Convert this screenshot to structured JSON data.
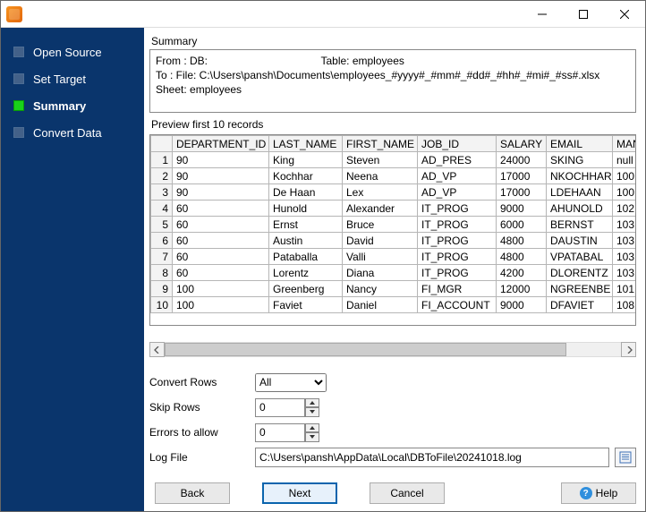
{
  "titlebar": {
    "title": ""
  },
  "sidebar": {
    "steps": [
      {
        "label": "Open Source",
        "active": false
      },
      {
        "label": "Set Target",
        "active": false
      },
      {
        "label": "Summary",
        "active": true
      },
      {
        "label": "Convert Data",
        "active": false
      }
    ]
  },
  "summary": {
    "heading": "Summary",
    "line1": "From : DB:",
    "line1_table_label": "Table: employees",
    "line2": "To : File: C:\\Users\\pansh\\Documents\\employees_#yyyy#_#mm#_#dd#_#hh#_#mi#_#ss#.xlsx Sheet: employees"
  },
  "preview": {
    "heading": "Preview first 10 records",
    "columns": [
      "DEPARTMENT_ID",
      "LAST_NAME",
      "FIRST_NAME",
      "JOB_ID",
      "SALARY",
      "EMAIL",
      "MANAG"
    ],
    "rows": [
      {
        "n": "1",
        "cells": [
          "90",
          "King",
          "Steven",
          "AD_PRES",
          "24000",
          "SKING",
          "null"
        ]
      },
      {
        "n": "2",
        "cells": [
          "90",
          "Kochhar",
          "Neena",
          "AD_VP",
          "17000",
          "NKOCHHAR",
          "100"
        ]
      },
      {
        "n": "3",
        "cells": [
          "90",
          "De Haan",
          "Lex",
          "AD_VP",
          "17000",
          "LDEHAAN",
          "100"
        ]
      },
      {
        "n": "4",
        "cells": [
          "60",
          "Hunold",
          "Alexander",
          "IT_PROG",
          "9000",
          "AHUNOLD",
          "102"
        ]
      },
      {
        "n": "5",
        "cells": [
          "60",
          "Ernst",
          "Bruce",
          "IT_PROG",
          "6000",
          "BERNST",
          "103"
        ]
      },
      {
        "n": "6",
        "cells": [
          "60",
          "Austin",
          "David",
          "IT_PROG",
          "4800",
          "DAUSTIN",
          "103"
        ]
      },
      {
        "n": "7",
        "cells": [
          "60",
          "Pataballa",
          "Valli",
          "IT_PROG",
          "4800",
          "VPATABAL",
          "103"
        ]
      },
      {
        "n": "8",
        "cells": [
          "60",
          "Lorentz",
          "Diana",
          "IT_PROG",
          "4200",
          "DLORENTZ",
          "103"
        ]
      },
      {
        "n": "9",
        "cells": [
          "100",
          "Greenberg",
          "Nancy",
          "FI_MGR",
          "12000",
          "NGREENBE",
          "101"
        ]
      },
      {
        "n": "10",
        "cells": [
          "100",
          "Faviet",
          "Daniel",
          "FI_ACCOUNT",
          "9000",
          "DFAVIET",
          "108"
        ]
      }
    ]
  },
  "form": {
    "convert_rows_label": "Convert Rows",
    "convert_rows_value": "All",
    "skip_rows_label": "Skip Rows",
    "skip_rows_value": "0",
    "errors_label": "Errors to allow",
    "errors_value": "0",
    "log_file_label": "Log File",
    "log_file_value": "C:\\Users\\pansh\\AppData\\Local\\DBToFile\\20241018.log"
  },
  "footer": {
    "back": "Back",
    "next": "Next",
    "cancel": "Cancel",
    "help": "Help"
  }
}
